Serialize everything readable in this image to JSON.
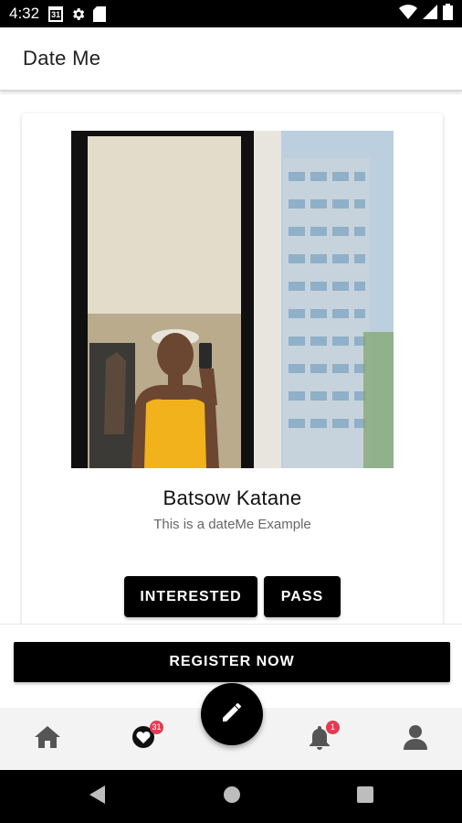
{
  "status_bar": {
    "time": "4:32",
    "calendar_day": "31",
    "icons": [
      "calendar-icon",
      "gear-icon",
      "sd-card-icon",
      "wifi-icon",
      "cellular-signal-icon",
      "battery-icon"
    ]
  },
  "app_bar": {
    "title": "Date Me"
  },
  "profile": {
    "name": "Batsow Katane",
    "bio": "This is a dateMe Example"
  },
  "actions": {
    "interested_label": "INTERESTED",
    "pass_label": "PASS"
  },
  "register": {
    "label": "REGISTER NOW"
  },
  "bottom_nav": {
    "items": [
      {
        "name": "home-icon"
      },
      {
        "name": "favorites-icon",
        "badge": "31"
      },
      {
        "name": "notifications-icon",
        "badge": "1"
      },
      {
        "name": "profile-icon"
      }
    ],
    "fab_icon": "pencil-icon"
  },
  "colors": {
    "primary": "#000000",
    "badge": "#e53a52",
    "nav_background": "#f3f3f3",
    "bio_text": "#666666"
  }
}
